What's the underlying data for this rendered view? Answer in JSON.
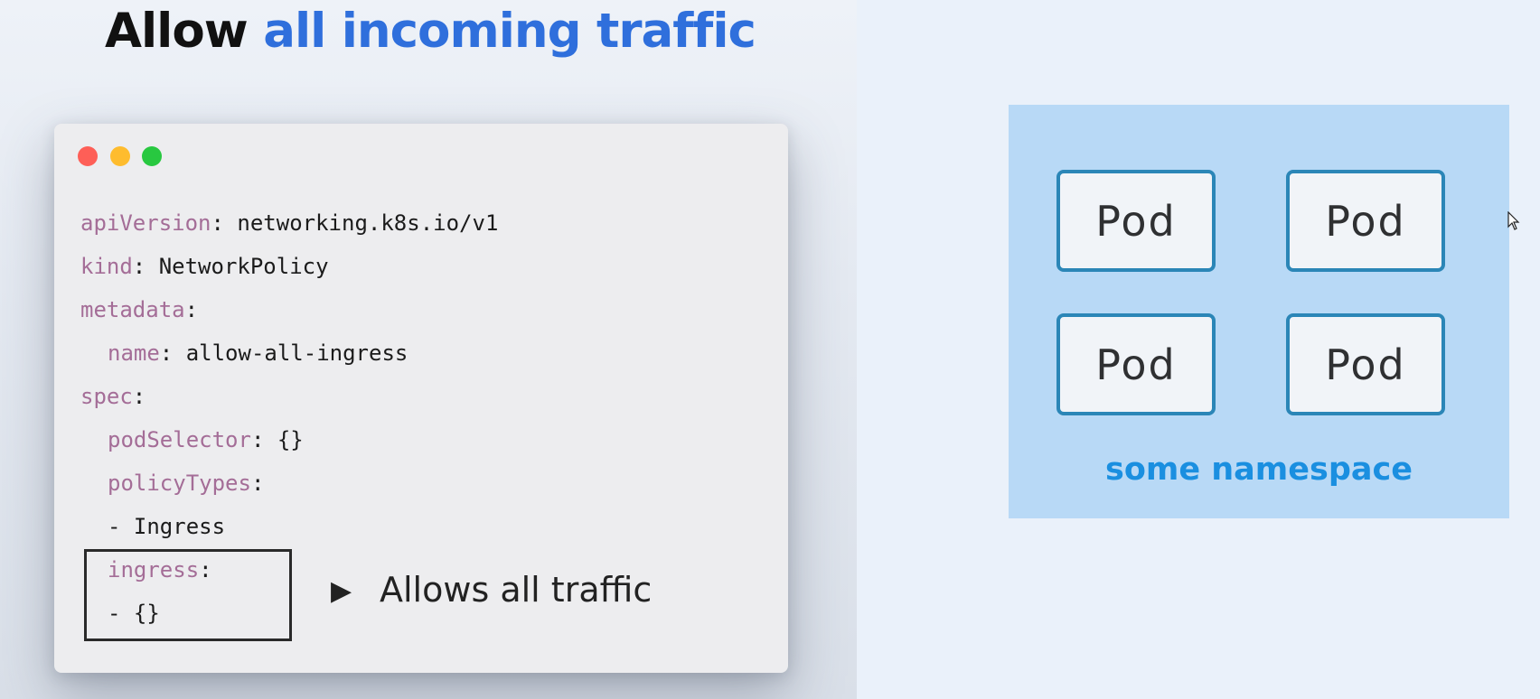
{
  "title": {
    "part1": "Allow ",
    "part2": "all incoming traffic"
  },
  "code": {
    "lines": [
      {
        "key": "apiVersion",
        "sep": ": ",
        "value": "networking.k8s.io/v1"
      },
      {
        "key": "kind",
        "sep": ": ",
        "value": "NetworkPolicy"
      },
      {
        "key": "metadata",
        "sep": ":",
        "value": ""
      },
      {
        "key": "name",
        "sep": ": ",
        "value": "allow-all-ingress"
      },
      {
        "key": "spec",
        "sep": ":",
        "value": ""
      },
      {
        "key": "podSelector",
        "sep": ": ",
        "value": "{}"
      },
      {
        "key": "policyTypes",
        "sep": ":",
        "value": ""
      },
      {
        "key": "",
        "sep": "",
        "value": "- Ingress"
      },
      {
        "key": "ingress",
        "sep": ":",
        "value": ""
      },
      {
        "key": "",
        "sep": "",
        "value": "- {}"
      }
    ]
  },
  "annotation": {
    "arrow": "▶",
    "text": "Allows all traffic"
  },
  "diagram": {
    "pods": [
      "Pod",
      "Pod",
      "Pod",
      "Pod"
    ],
    "namespace_label": "some namespace"
  },
  "colors": {
    "title_accent": "#2f6fdc",
    "yaml_key": "#a46d97",
    "namespace_bg": "#b8d9f6",
    "pod_border": "#2b86b7",
    "namespace_label": "#1a8fe0"
  }
}
